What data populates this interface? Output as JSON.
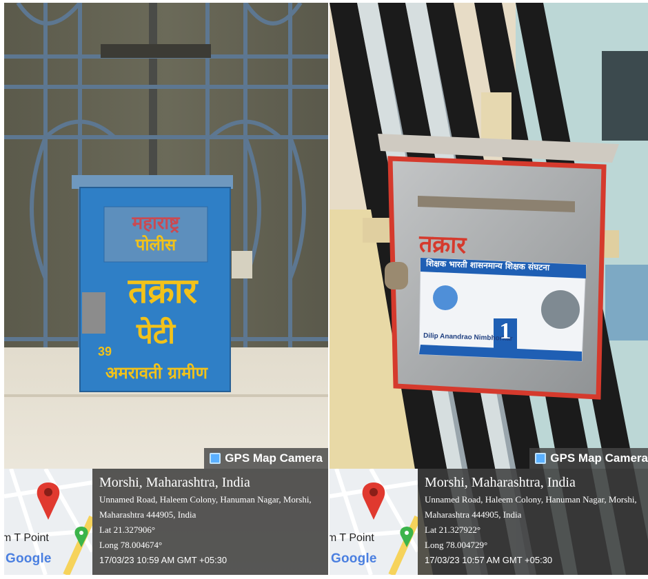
{
  "photos": [
    {
      "box_text": {
        "top": "महाराष्ट्र",
        "second": "पोलीस",
        "main": "तक्रार",
        "sub": "पेटी",
        "number": "39",
        "bottom": "अमरावती ग्रामीण"
      },
      "watermark": "GPS Map Camera",
      "map_label": "am T Point",
      "map_logo": "Google",
      "location_title": "Morshi, Maharashtra, India",
      "address": "Unnamed Road, Haleem Colony, Hanuman Nagar, Morshi, Maharashtra 444905, India",
      "lat": "Lat 21.327906°",
      "long": "Long 78.004674°",
      "datetime": "17/03/23 10:59 AM GMT +05:30"
    },
    {
      "box_text": {
        "poster_header": "शिक्षक भारती शासनमान्य शिक्षक संघटना",
        "candidate_name": "Dilip Anandrao Nimbhorkar",
        "ballot_number": "1",
        "partial_top": "तक्रार"
      },
      "watermark": "GPS Map Camera",
      "map_label": "am T Point",
      "map_logo": "Google",
      "location_title": "Morshi, Maharashtra, India",
      "address": "Unnamed Road, Haleem Colony, Hanuman Nagar, Morshi, Maharashtra 444905, India",
      "lat": "Lat 21.327922°",
      "long": "Long 78.004729°",
      "datetime": "17/03/23 10:57 AM GMT +05:30"
    }
  ],
  "colors": {
    "box_blue": "#2f7fc6",
    "box_yellow": "#f2c21a",
    "metal_grey": "#a9acae",
    "box_red": "#d53a2d",
    "wall_dark": "#1f1f1f",
    "pin_red": "#e0392f",
    "pin_green": "#3cb44b"
  }
}
